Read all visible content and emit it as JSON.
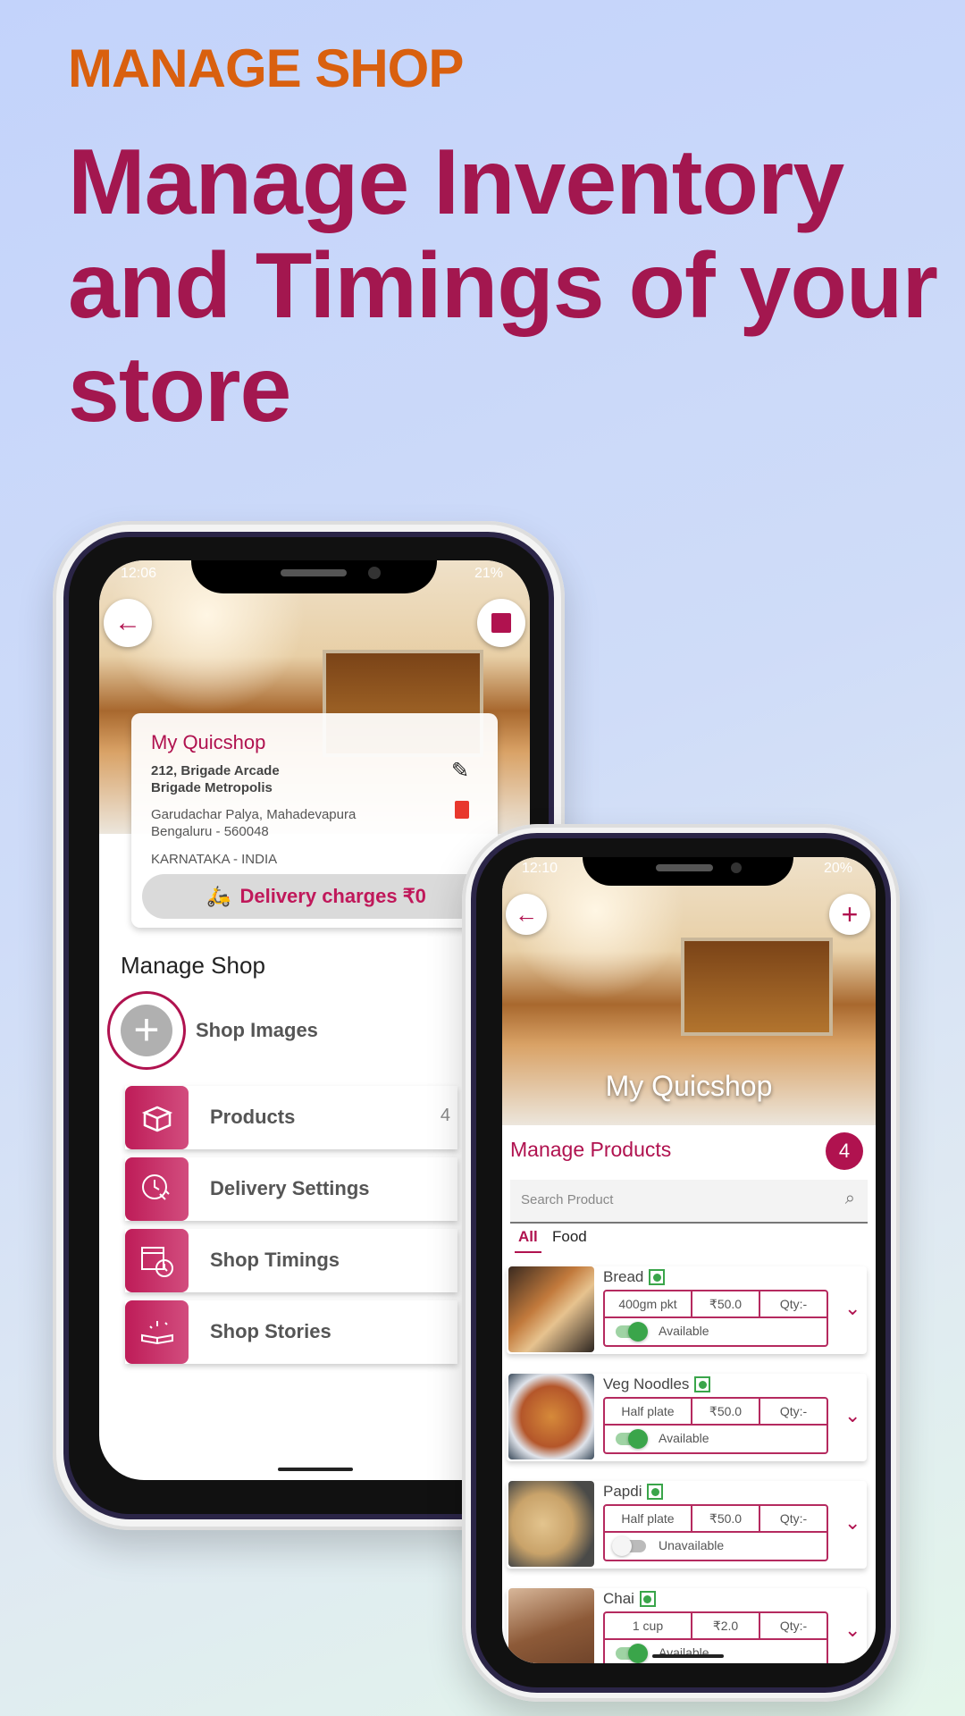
{
  "header": {
    "kicker": "MANAGE SHOP",
    "headline_lines": [
      "Manage Inventory",
      "and Timings of your",
      "store"
    ]
  },
  "colors": {
    "kicker": "#d9600f",
    "headline": "#a3174f",
    "accent": "#b0124f",
    "veg": "#3aa54a"
  },
  "phone1": {
    "status": {
      "time": "12:06",
      "battery": "21%"
    },
    "shop": {
      "name": "My Quicshop",
      "address1": "212, Brigade Arcade",
      "address2": "Brigade Metropolis",
      "address3": "Garudachar Palya, Mahadevapura",
      "address4": "Bengaluru - 560048",
      "region": "KARNATAKA - INDIA",
      "delivery": "Delivery charges ₹0"
    },
    "section_title": "Manage Shop",
    "shop_images_label": "Shop Images",
    "menu": [
      {
        "label": "Products",
        "count": "4",
        "icon": "box-icon"
      },
      {
        "label": "Delivery Settings",
        "icon": "delivery-clock-icon"
      },
      {
        "label": "Shop Timings",
        "icon": "shop-clock-icon"
      },
      {
        "label": "Shop Stories",
        "icon": "book-sparkle-icon"
      }
    ]
  },
  "phone2": {
    "status": {
      "time": "12:10",
      "battery": "20%"
    },
    "hero_title": "My Quicshop",
    "title": "Manage Products",
    "count": "4",
    "search_placeholder": "Search Product",
    "tabs": [
      {
        "label": "All",
        "active": true
      },
      {
        "label": "Food",
        "active": false
      }
    ],
    "products": [
      {
        "name": "Bread",
        "unit": "400gm pkt",
        "price": "₹50.0",
        "qty": "Qty:-",
        "status": "Available",
        "available": true
      },
      {
        "name": "Veg Noodles",
        "unit": "Half plate",
        "price": "₹50.0",
        "qty": "Qty:-",
        "status": "Available",
        "available": true
      },
      {
        "name": "Papdi",
        "unit": "Half plate",
        "price": "₹50.0",
        "qty": "Qty:-",
        "status": "Unavailable",
        "available": false
      },
      {
        "name": "Chai",
        "unit": "1 cup",
        "price": "₹2.0",
        "qty": "Qty:-",
        "status": "Available",
        "available": true
      }
    ]
  }
}
